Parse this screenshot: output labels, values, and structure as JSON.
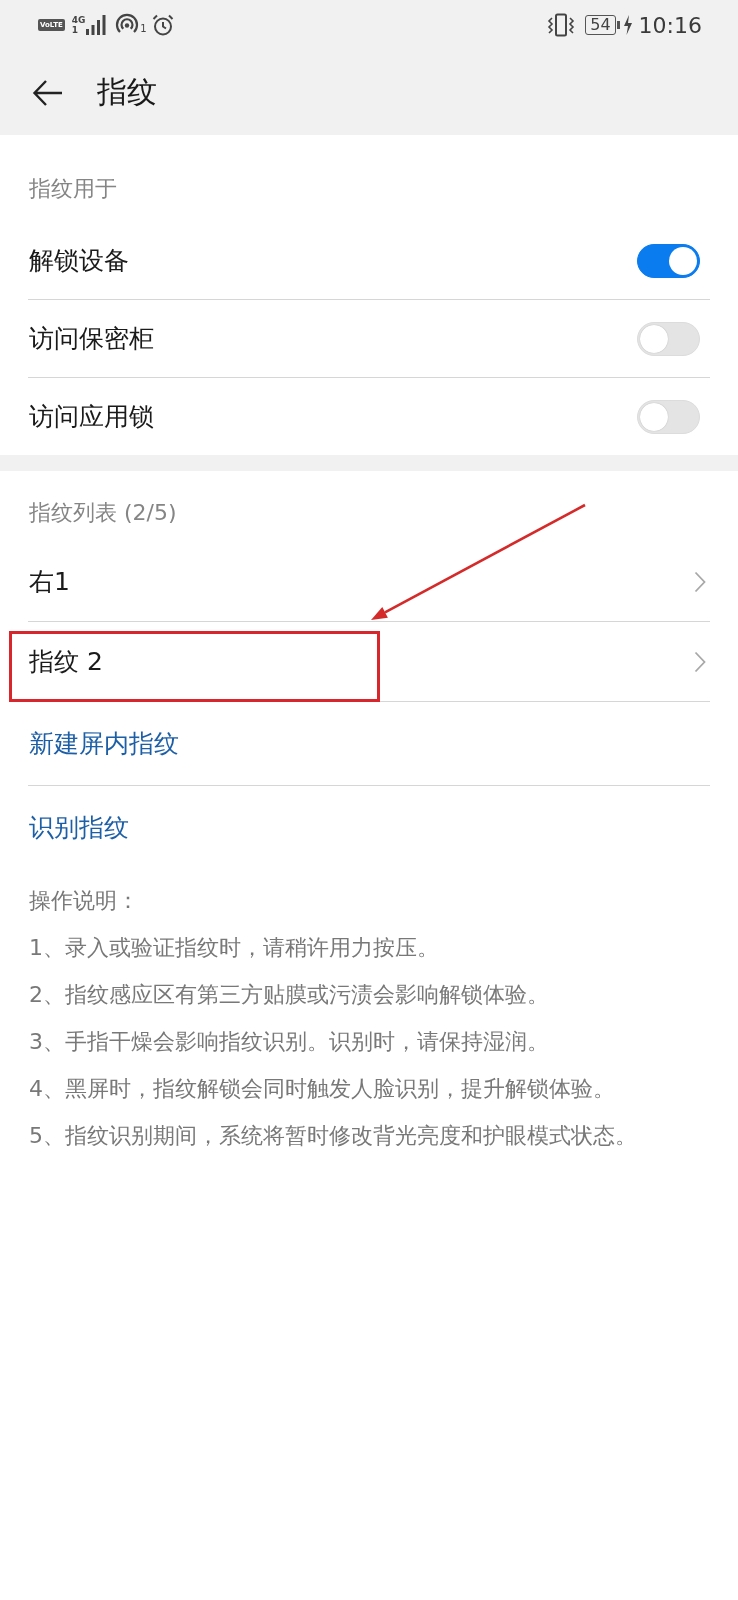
{
  "status_bar": {
    "volte": "VoLTE",
    "network": "4G",
    "sim": "1",
    "hotspot_count": "1",
    "battery": "54",
    "time": "10:16"
  },
  "header": {
    "title": "指纹"
  },
  "usage": {
    "heading": "指纹用于",
    "items": [
      {
        "label": "解锁设备",
        "on": true
      },
      {
        "label": "访问保密柜",
        "on": false
      },
      {
        "label": "访问应用锁",
        "on": false
      }
    ]
  },
  "fingerprints": {
    "heading": "指纹列表 (2/5)",
    "items": [
      {
        "label": "右1",
        "highlighted": false
      },
      {
        "label": "指纹 2",
        "highlighted": true
      }
    ],
    "actions": [
      "新建屏内指纹",
      "识别指纹"
    ]
  },
  "instructions": {
    "title": "操作说明：",
    "lines": [
      "1、录入或验证指纹时，请稍许用力按压。",
      "2、指纹感应区有第三方贴膜或污渍会影响解锁体验。",
      "3、手指干燥会影响指纹识别。识别时，请保持湿润。",
      "4、黑屏时，指纹解锁会同时触发人脸识别，提升解锁体验。",
      "5、指纹识别期间，系统将暂时修改背光亮度和护眼模式状态。"
    ]
  }
}
